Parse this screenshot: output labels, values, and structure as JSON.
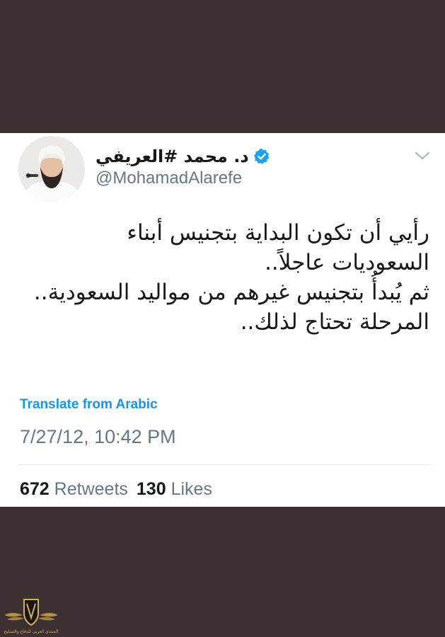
{
  "tweet": {
    "display_name": "د. محمد #العريفي",
    "handle": "@MohamadAlarefe",
    "text_lines": [
      "رأيي أن تكون البداية بتجنيس أبناء",
      "السعوديات عاجلاً..",
      "ثم يُبدأُ بتجنيس غيرهم من مواليد السعودية..",
      "المرحلة تحتاج لذلك.."
    ],
    "translate_label": "Translate from Arabic",
    "timestamp": "7/27/12, 10:42 PM",
    "retweets_count": "672",
    "retweets_label": "Retweets",
    "likes_count": "130",
    "likes_label": "Likes"
  },
  "watermark": {
    "text": "المنتدى العربي للدفاع والتسليح"
  },
  "colors": {
    "background": "#3c3030",
    "card": "#ffffff",
    "text_primary": "#14171a",
    "text_secondary": "#657786",
    "link": "#1b95e0",
    "verified": "#1da1f2",
    "divider": "#e1e8ed"
  },
  "icons": {
    "verified": "verified-badge-icon",
    "menu": "chevron-down-icon",
    "avatar": "avatar"
  }
}
